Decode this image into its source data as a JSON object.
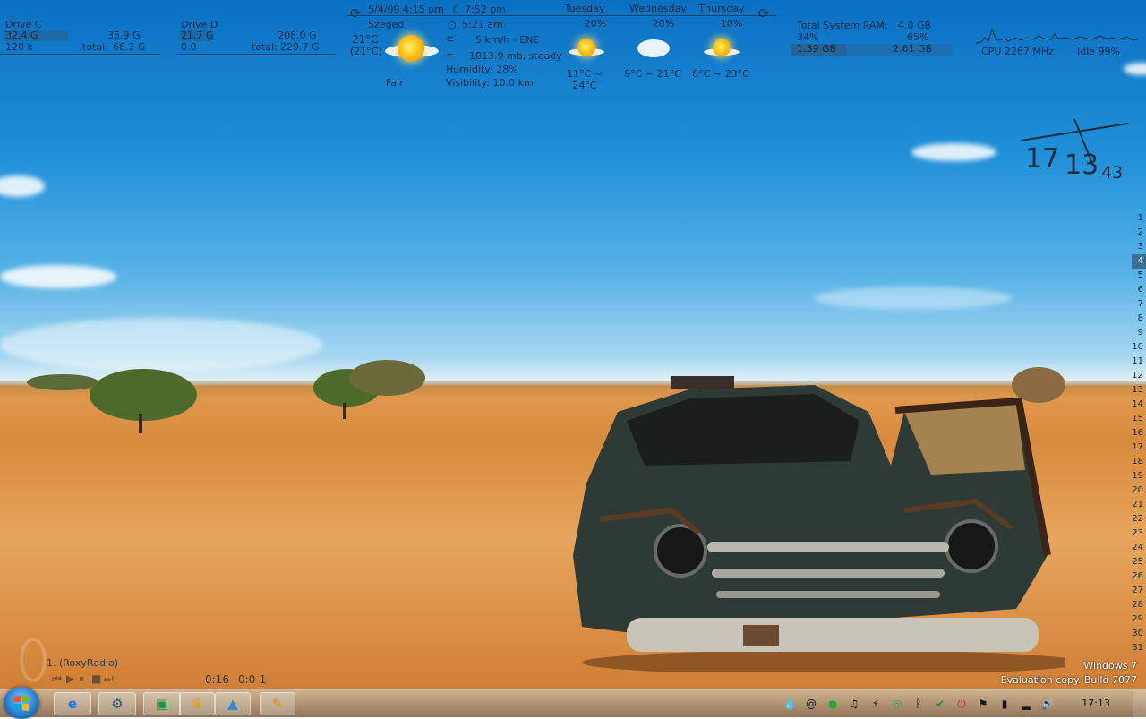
{
  "drives": [
    {
      "name": "Drive C",
      "used": "32.4 G",
      "free": "35.9 G",
      "io": "120 k",
      "total_label": "total:",
      "total": "68.3 G"
    },
    {
      "name": "Drive D",
      "used": "21.7 G",
      "free": "208.0 G",
      "io": "0.0",
      "total_label": "total:",
      "total": "229.7 G"
    }
  ],
  "weather": {
    "datetime": "5/4/09 4:15 pm",
    "city": "Szeged",
    "temp": "21°C",
    "feels": "(21°C)",
    "condition": "Fair",
    "sunset": "7:52 pm",
    "sunrise": "5:21 am",
    "wind": "5 km/h - ENE",
    "pressure": "1013.9 mb, steady",
    "humidity": "Humidity: 28%",
    "visibility": "Visibility: 10.0 km",
    "forecast": [
      {
        "day": "Tuesday",
        "chance": "20%",
        "range": "11°C ~ 24°C",
        "icon": "sun-icon"
      },
      {
        "day": "Wednesday",
        "chance": "20%",
        "range": "9°C ~ 21°C",
        "icon": "cloud-icon"
      },
      {
        "day": "Thursday",
        "chance": "10%",
        "range": "8°C ~ 23°C",
        "icon": "sun-icon"
      }
    ]
  },
  "ram": {
    "label": "Total System RAM:",
    "total": "4.0 GB",
    "used_pct": "34%",
    "free_pct": "65%",
    "used": "1.39 GB",
    "free": "2.61 GB",
    "used_fraction": 0.34
  },
  "cpu": {
    "freq": "CPU 2267 MHz",
    "idle": "Idle 99%"
  },
  "clock": {
    "hours": "17",
    "minutes": "13",
    "seconds": "43"
  },
  "days": {
    "items": [
      "1",
      "2",
      "3",
      "4",
      "5",
      "6",
      "7",
      "8",
      "9",
      "10",
      "11",
      "12",
      "13",
      "14",
      "15",
      "16",
      "17",
      "18",
      "19",
      "20",
      "21",
      "22",
      "23",
      "24",
      "25",
      "26",
      "27",
      "28",
      "29",
      "30",
      "31"
    ],
    "current": "4"
  },
  "player": {
    "track": "1.  (RoxyRadio)",
    "time": "0:16",
    "counter": "0:0-1"
  },
  "watermark": {
    "line1": "Windows 7",
    "line2": "Evaluation copy. Build 7077"
  },
  "taskbar": {
    "time": "17:13",
    "apps": [
      {
        "name": "internet-explorer",
        "icon": "ie-icon",
        "glyph": "e",
        "color": "#1e78d8"
      },
      {
        "name": "settings-app",
        "icon": "gear-app-icon",
        "glyph": "⚙",
        "color": "#2a5a7a"
      },
      {
        "name": "green-app",
        "icon": "green-square-icon",
        "glyph": "▣",
        "color": "#1f9a3a"
      },
      {
        "name": "crown-app",
        "icon": "crown-icon",
        "glyph": "♛",
        "color": "#d8a020"
      },
      {
        "name": "image-app",
        "icon": "picture-icon",
        "glyph": "▲",
        "color": "#2a8ad8"
      },
      {
        "name": "notes-app",
        "icon": "pencil-icon",
        "glyph": "✎",
        "color": "#d89020"
      }
    ],
    "tray": [
      "drop-icon",
      "at-sign-icon",
      "ball-icon",
      "music-icon",
      "usb-icon",
      "chat-icon",
      "bluetooth-icon",
      "shield-icon",
      "power-icon",
      "flag-icon",
      "battery-icon",
      "network-icon",
      "volume-icon"
    ]
  },
  "colors": {
    "accent": "#1e78d8",
    "text": "#0d2a44"
  }
}
